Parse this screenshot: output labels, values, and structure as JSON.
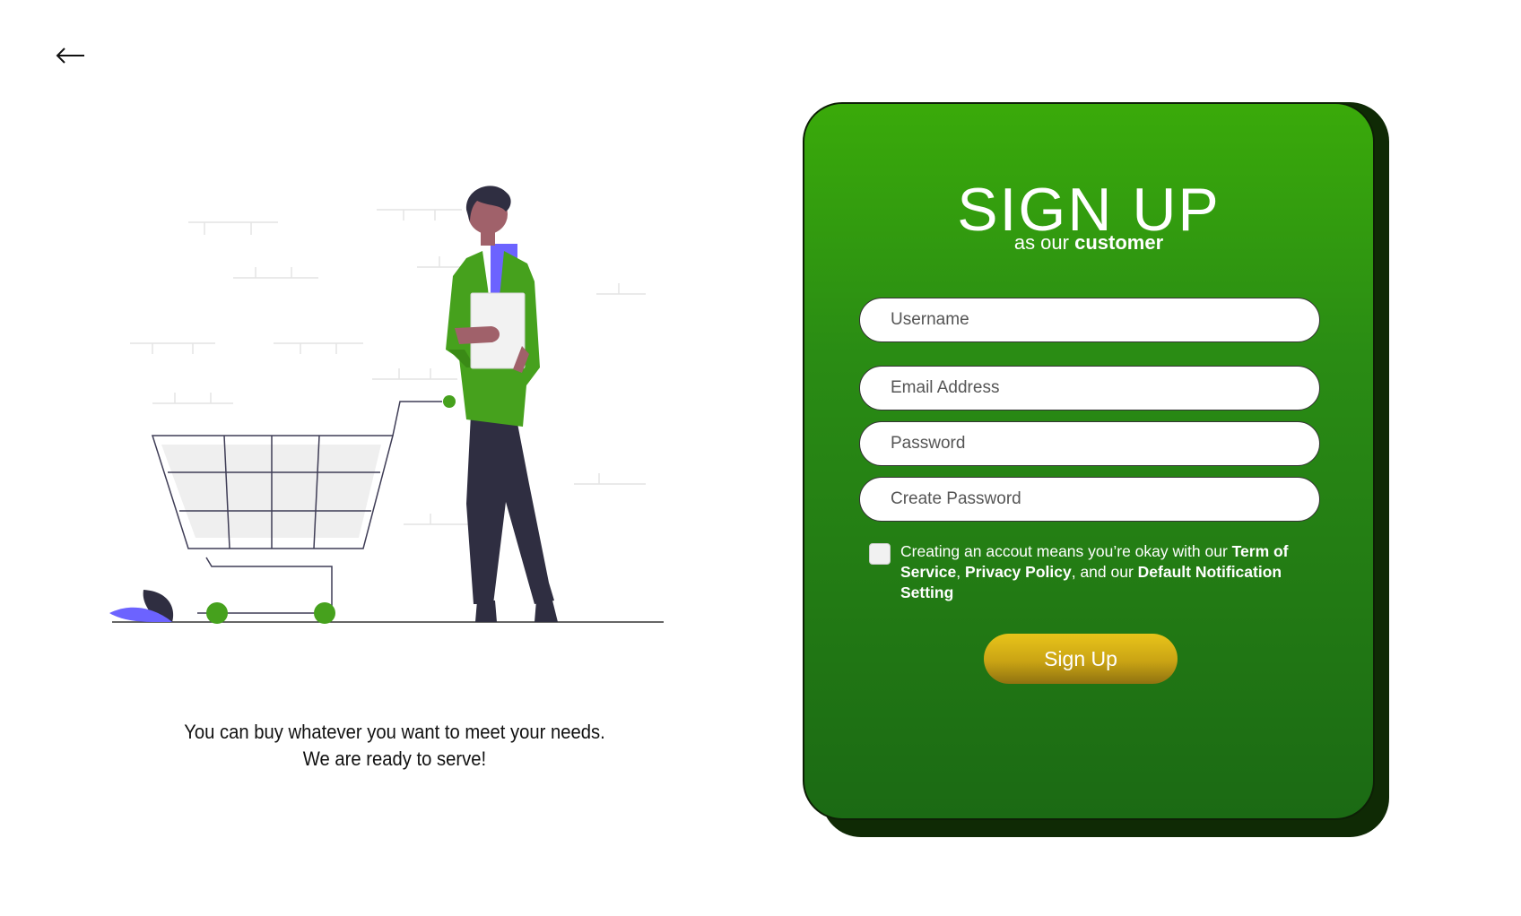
{
  "nav": {
    "back_icon": "arrow-left-icon"
  },
  "hero": {
    "illustration": "person-with-shopping-cart",
    "tagline_line1": "You can buy whatever you want to meet your needs.",
    "tagline_line2": "We are ready to serve!"
  },
  "form": {
    "title": "SIGN UP",
    "subtitle_prefix": "as our",
    "subtitle_bold": "customer",
    "fields": [
      {
        "placeholder": "Username",
        "value": ""
      },
      {
        "placeholder": "Email Address",
        "value": ""
      },
      {
        "placeholder": "Password",
        "value": ""
      },
      {
        "placeholder": "Create Password",
        "value": ""
      }
    ],
    "terms": {
      "text1": "Creating an accout means you’re okay with our ",
      "bold1": "Term of Service",
      "text2": ", ",
      "bold2": "Privacy Policy",
      "text3": ", and our ",
      "bold3": "Default Notification Setting"
    },
    "checkbox_checked": false,
    "submit_label": "Sign Up"
  },
  "colors": {
    "card_top": "#3aaa0a",
    "card_bottom": "#1b6a14",
    "card_shadow": "#0f2a05",
    "button": "#caa414",
    "accent_green": "#46a11d",
    "accent_purple": "#6c63ff"
  }
}
